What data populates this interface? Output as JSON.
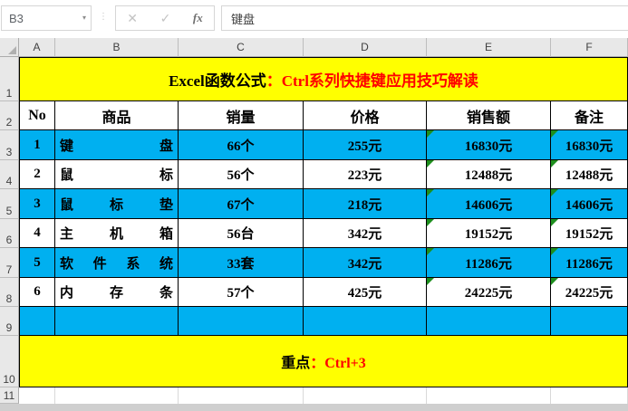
{
  "formula_bar": {
    "cell_reference": "B3",
    "value": "键盘",
    "dropdown_icon": "▾",
    "separator_icon": "⋮",
    "cancel_icon": "✕",
    "confirm_icon": "✓",
    "fx_icon": "fx"
  },
  "grid": {
    "column_headers": [
      "A",
      "B",
      "C",
      "D",
      "E",
      "F"
    ],
    "row_numbers": [
      "1",
      "2",
      "3",
      "4",
      "5",
      "6",
      "7",
      "8",
      "9",
      "10",
      "11"
    ]
  },
  "title": {
    "black_part": "Excel函数公式",
    "red_part": "：Ctrl系列快捷键应用技巧解读"
  },
  "table": {
    "headers": {
      "no": "No",
      "product": "商品",
      "qty": "销量",
      "price": "价格",
      "sales": "销售额",
      "note": "备注"
    },
    "rows": [
      {
        "no": "1",
        "product": "键盘",
        "qty": "66个",
        "price": "255元",
        "sales": "16830元",
        "note": "16830元"
      },
      {
        "no": "2",
        "product": "鼠标",
        "qty": "56个",
        "price": "223元",
        "sales": "12488元",
        "note": "12488元"
      },
      {
        "no": "3",
        "product": "鼠标垫",
        "qty": "67个",
        "price": "218元",
        "sales": "14606元",
        "note": "14606元"
      },
      {
        "no": "4",
        "product": "主机箱",
        "qty": "56台",
        "price": "342元",
        "sales": "19152元",
        "note": "19152元"
      },
      {
        "no": "5",
        "product": "软件系统",
        "qty": "33套",
        "price": "342元",
        "sales": "11286元",
        "note": "11286元"
      },
      {
        "no": "6",
        "product": "内存条",
        "qty": "57个",
        "price": "425元",
        "sales": "24225元",
        "note": "24225元"
      }
    ]
  },
  "footer": {
    "black_part": "重点",
    "red_part": "：Ctrl+3"
  },
  "colors": {
    "row_highlight": "#00B0F0",
    "banner_yellow": "#FFFF00",
    "accent_red": "#FF0000",
    "indicator_green": "#1E8F1E"
  }
}
